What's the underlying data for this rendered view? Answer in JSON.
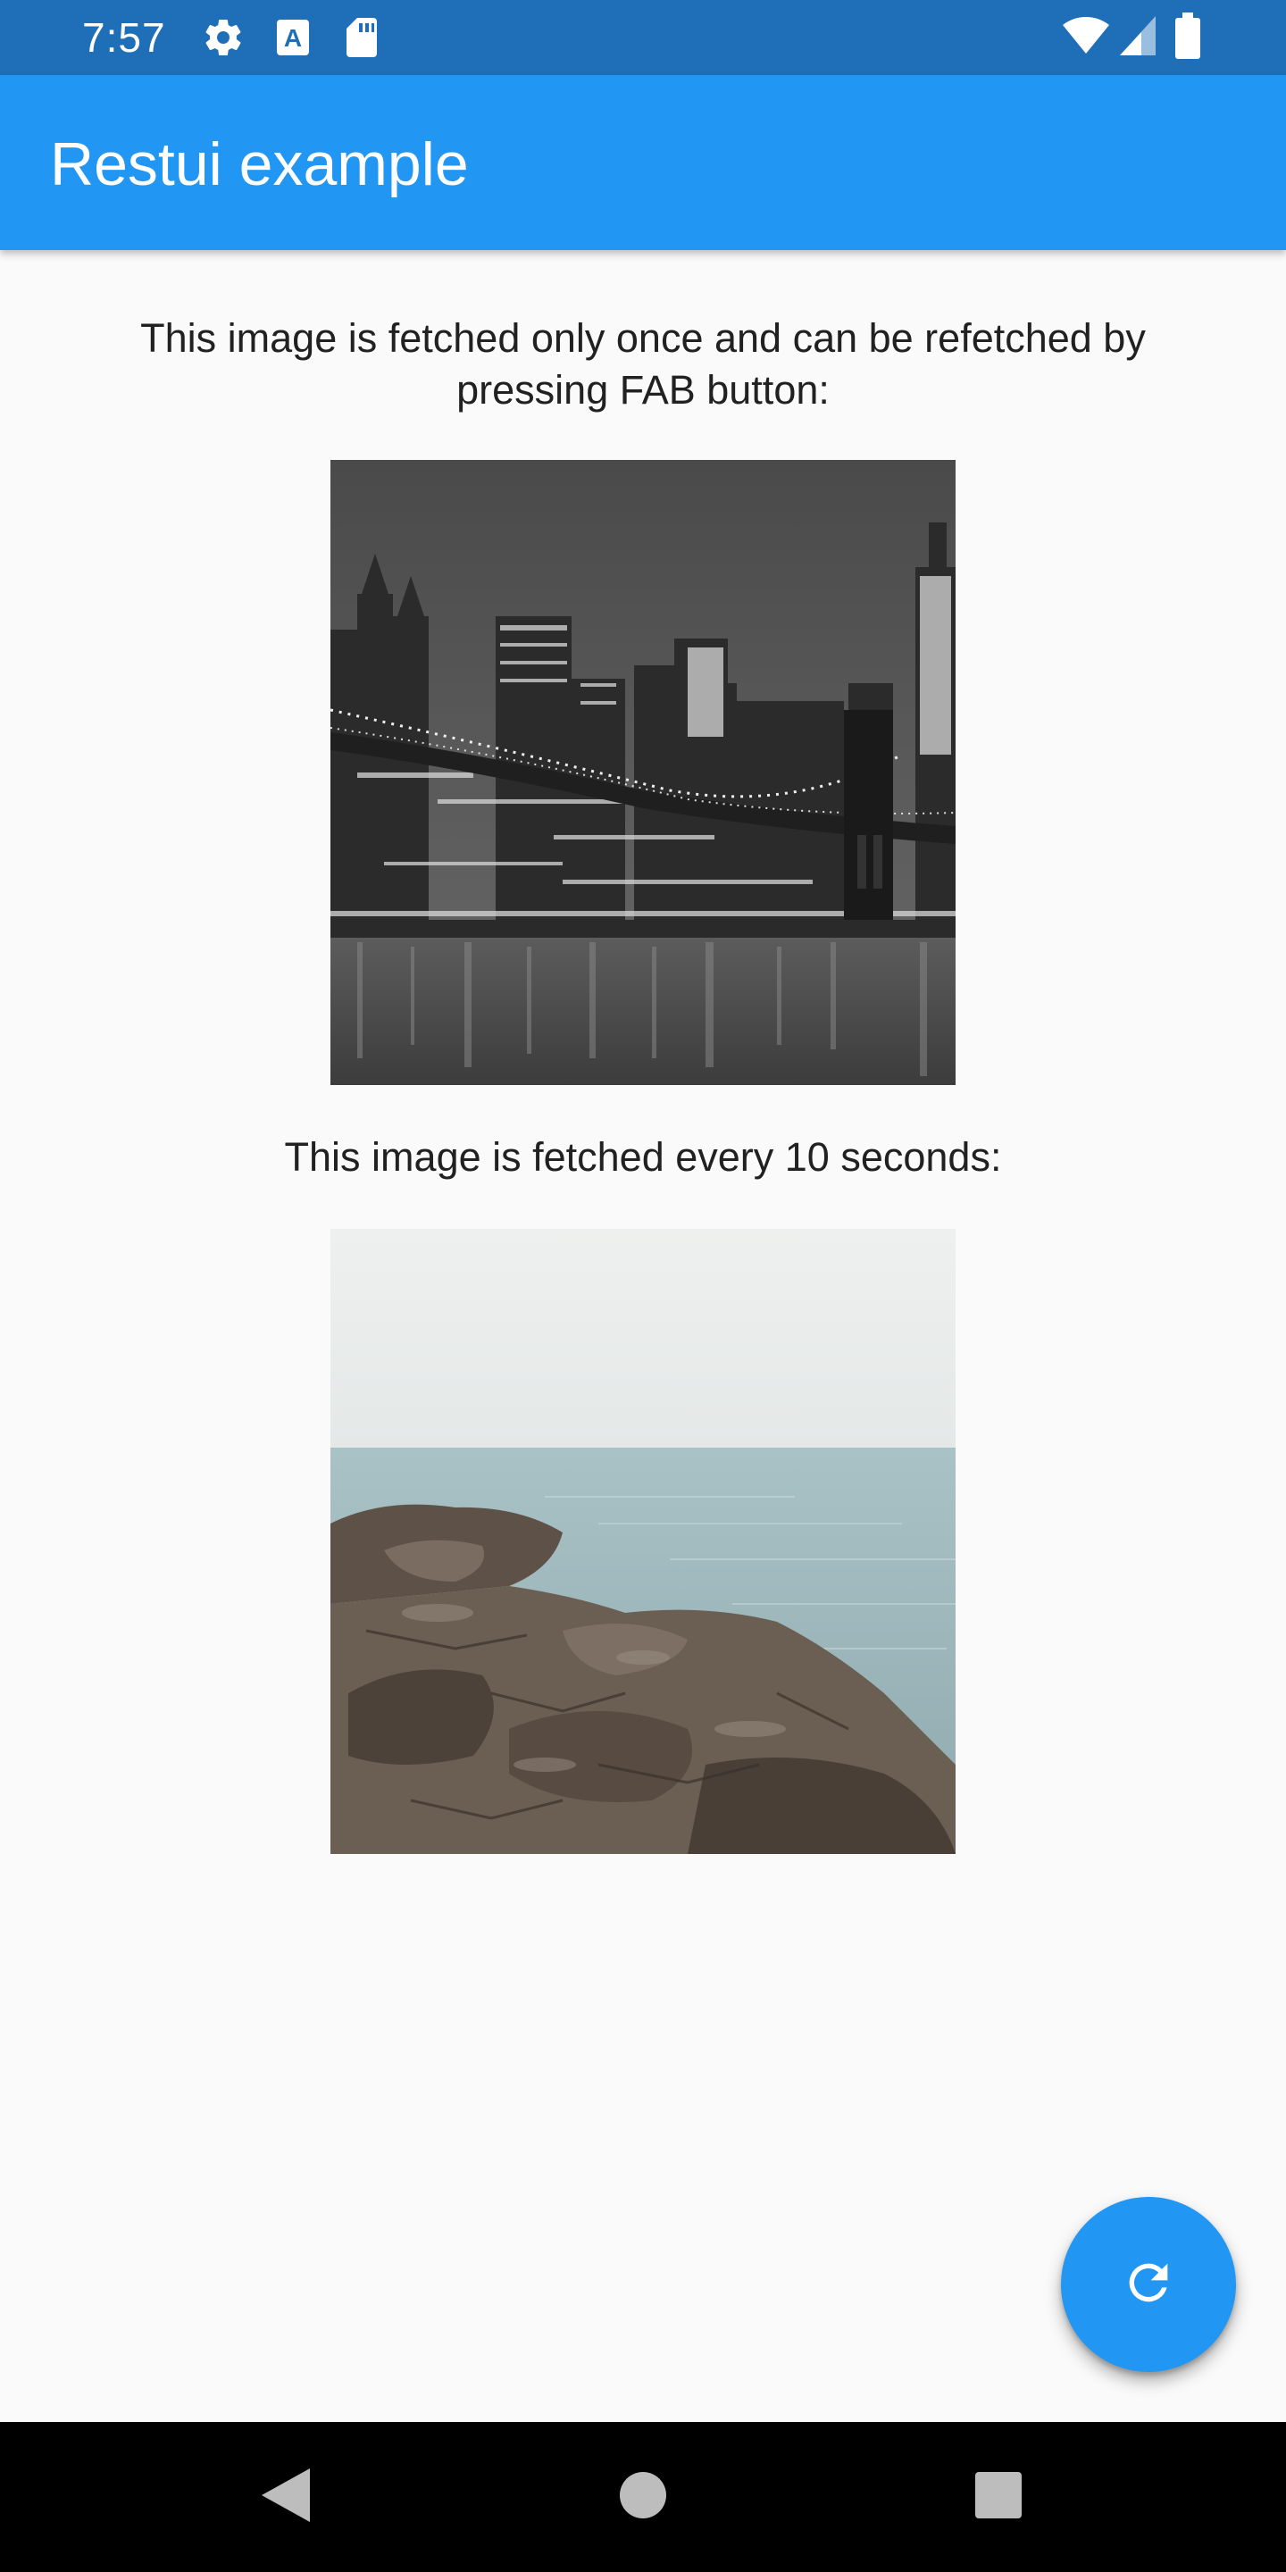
{
  "status_bar": {
    "time": "7:57",
    "icons_left": [
      "settings-icon",
      "a-keyboard-icon",
      "sd-card-icon"
    ],
    "icons_right": [
      "wifi-icon",
      "cell-signal-icon",
      "battery-icon"
    ]
  },
  "app_bar": {
    "title": "Restui example",
    "color": "#2196f3"
  },
  "content": {
    "caption_1": "This image is fetched only once and can be refetched by pressing FAB button:",
    "image_1": "city-bridge-night-photo",
    "caption_2": "This image is fetched every 10 seconds:",
    "image_2": "rocky-shore-sea-photo"
  },
  "fab": {
    "icon": "refresh-icon",
    "color": "#2196f3"
  },
  "nav_bar": {
    "buttons": [
      "back-icon",
      "home-icon",
      "recents-icon"
    ]
  }
}
